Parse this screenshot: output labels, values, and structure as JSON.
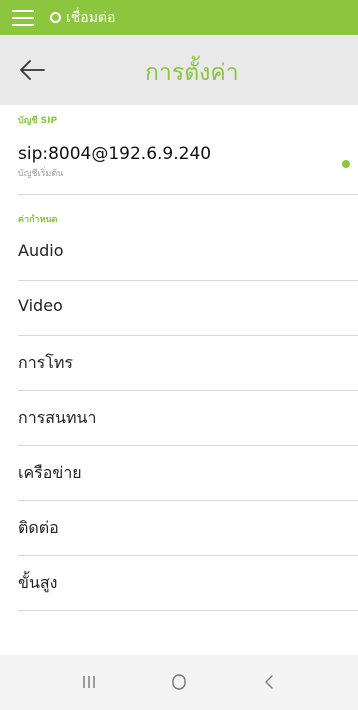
{
  "status_bar": {
    "connection_text": "เชื่อมต่อ",
    "color": "#8cc63f"
  },
  "header": {
    "title": "การตั้งค่า",
    "back_icon": "arrow-left-icon"
  },
  "sip_section": {
    "label": "บัญชี SIP",
    "account": {
      "uri": "sip:8004@192.6.9.240",
      "subtitle": "บัญชีเริ่มต้น",
      "status_color": "#8cc63f"
    }
  },
  "settings_section": {
    "label": "ค่ากำหนด",
    "items": [
      {
        "label": "Audio"
      },
      {
        "label": "Video"
      },
      {
        "label": "การโทร"
      },
      {
        "label": "การสนทนา"
      },
      {
        "label": "เครือข่าย"
      },
      {
        "label": "ติดต่อ"
      },
      {
        "label": "ขั้นสูง"
      }
    ]
  },
  "nav_bar": {
    "recent_icon": "recent-apps-icon",
    "home_icon": "home-icon",
    "back_icon": "back-icon"
  }
}
